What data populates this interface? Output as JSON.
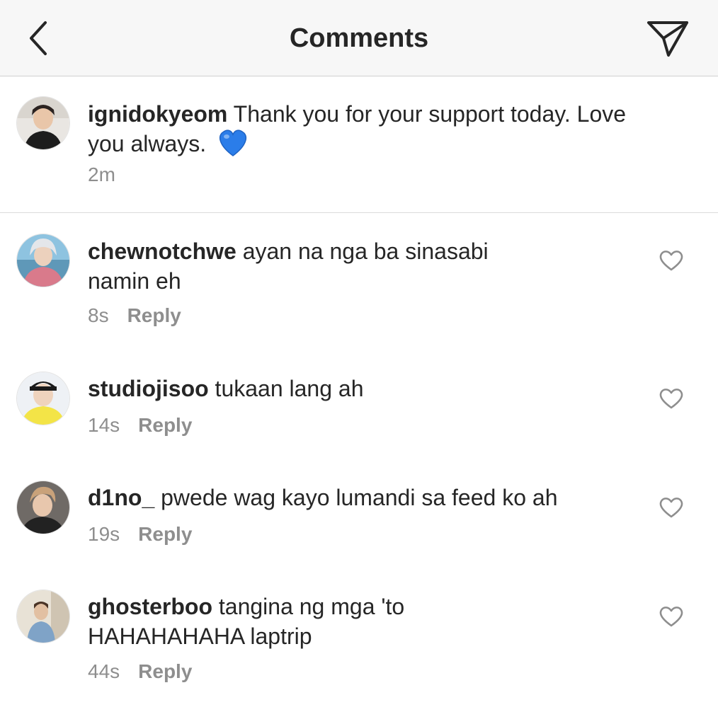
{
  "header": {
    "title": "Comments"
  },
  "caption": {
    "username": "ignidokyeom",
    "text": "Thank you for your support today. Love you always.",
    "emoji": "💙",
    "time": "2m"
  },
  "comments": [
    {
      "username": "chewnotchwe",
      "text": "ayan na nga ba sinasabi namin eh",
      "time": "8s",
      "reply_label": "Reply"
    },
    {
      "username": "studiojisoo",
      "text": "tukaan lang ah",
      "time": "14s",
      "reply_label": "Reply"
    },
    {
      "username": "d1no_",
      "text": "pwede wag kayo lumandi sa feed ko ah",
      "time": "19s",
      "reply_label": "Reply"
    },
    {
      "username": "ghosterboo",
      "text": "tangina ng mga 'to HAHAHAHAHA laptrip",
      "time": "44s",
      "reply_label": "Reply"
    }
  ],
  "icons": {
    "back": "chevron-left-icon",
    "send": "paper-plane-icon",
    "like": "heart-outline-icon",
    "reply_emoji": "blue-heart-emoji"
  },
  "colors": {
    "header_bg": "#f7f7f7",
    "text_primary": "#262626",
    "text_secondary": "#8e8e8e",
    "heart_blue": "#2b7de9"
  }
}
